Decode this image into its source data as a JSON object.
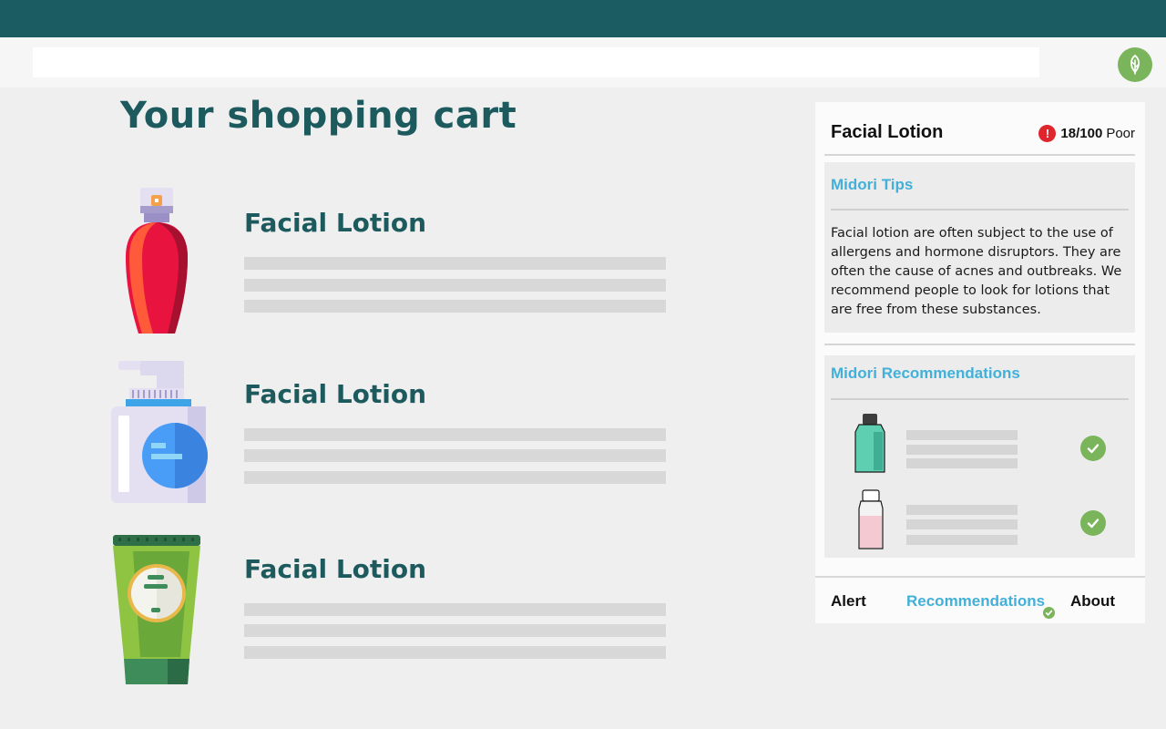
{
  "browser": {
    "url_value": ""
  },
  "extension": {
    "icon": "leaf-icon",
    "color": "#7ab55c"
  },
  "page": {
    "title": "Your shopping cart"
  },
  "cart": {
    "items": [
      {
        "name": "Facial Lotion",
        "image": "spray-bottle-image"
      },
      {
        "name": "Facial Lotion",
        "image": "pump-bottle-image"
      },
      {
        "name": "Facial Lotion",
        "image": "tube-image"
      }
    ]
  },
  "panel": {
    "title": "Facial Lotion",
    "score": {
      "value": "18/100",
      "rating": "Poor",
      "icon": "exclamation-icon",
      "color": "#e0262d"
    },
    "tips": {
      "title": "Midori Tips",
      "text": "Facial lotion are often subject to the use of allergens and hormone disruptors. They are often the cause of acnes and outbreaks. We recommend people to look for lotions that are free from these substances."
    },
    "recommendations": {
      "title": "Midori Recommendations",
      "items": [
        {
          "image": "teal-bottle-image",
          "status_icon": "check-icon"
        },
        {
          "image": "pink-bottle-image",
          "status_icon": "check-icon"
        }
      ]
    },
    "tabs": {
      "alert": "Alert",
      "recommendations": "Recommendations",
      "about": "About"
    }
  },
  "colors": {
    "header": "#1b5b62",
    "heading": "#1d5a5e",
    "accent": "#42b0d8",
    "success": "#7ab55c"
  }
}
